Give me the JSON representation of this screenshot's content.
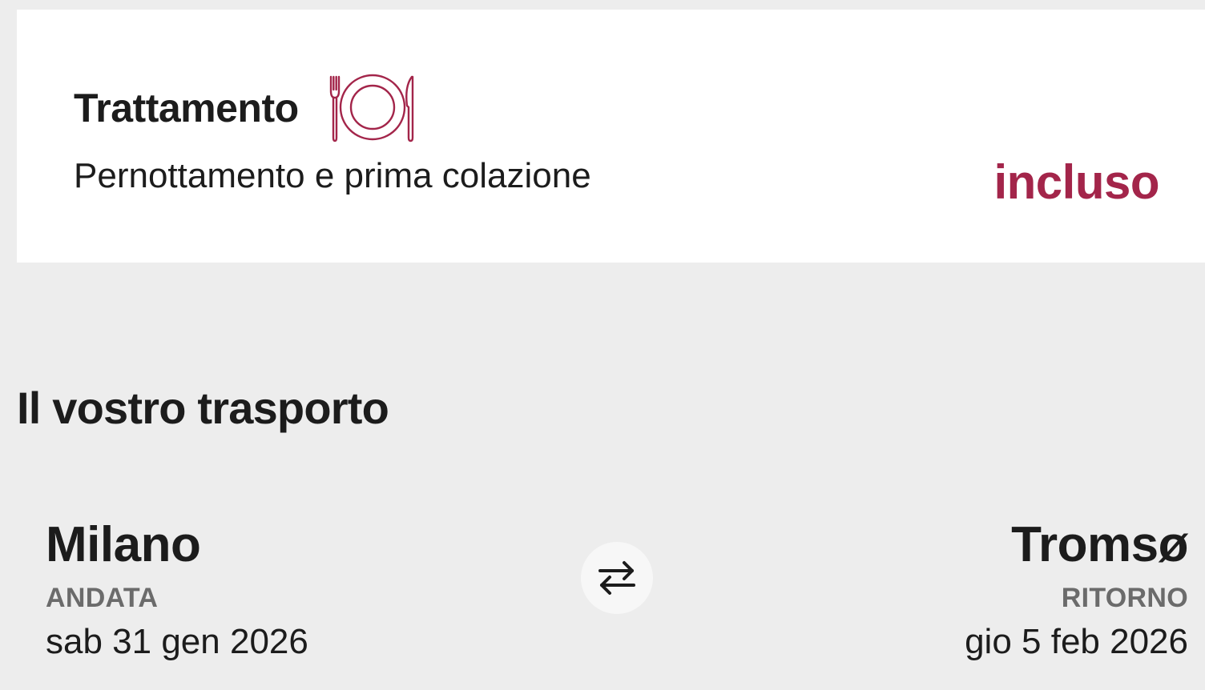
{
  "meal_card": {
    "title": "Trattamento",
    "icon": "plate-cutlery-icon",
    "description": "Pernottamento e prima colazione",
    "status": "incluso",
    "accent_color": "#a3254a"
  },
  "transport": {
    "section_title": "Il vostro trasporto",
    "outbound": {
      "city": "Milano",
      "label": "ANDATA",
      "date": "sab 31 gen 2026"
    },
    "return": {
      "city": "Tromsø",
      "label": "RITORNO",
      "date": "gio 5 feb 2026"
    },
    "swap_icon": "swap-arrows-icon"
  }
}
